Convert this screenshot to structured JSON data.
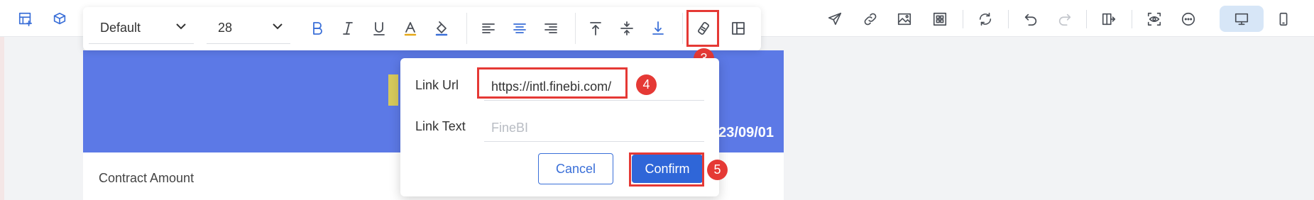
{
  "header": {
    "icons": [
      "add-chart-icon",
      "add-component-icon",
      "send-icon",
      "link-icon",
      "image-icon",
      "grid-icon",
      "refresh-icon",
      "undo-icon",
      "redo-icon",
      "export-icon",
      "preview-icon",
      "more-icon",
      "desktop-icon",
      "mobile-icon"
    ]
  },
  "toolbar": {
    "font_family": "Default",
    "font_size": "28",
    "buttons": [
      "bold-icon",
      "italic-icon",
      "underline-icon",
      "font-color-icon",
      "fill-color-icon",
      "align-left-icon",
      "align-center-icon",
      "align-right-icon",
      "align-top-icon",
      "align-middle-icon",
      "align-bottom-icon",
      "hyperlink-icon",
      "layout-icon"
    ]
  },
  "banner": {
    "date": "23/09/01"
  },
  "card": {
    "label": "Contract Amount"
  },
  "dialog": {
    "link_url_label": "Link Url",
    "link_url_value": "https://intl.finebi.com/",
    "link_text_label": "Link Text",
    "link_text_placeholder": "FineBI",
    "cancel_label": "Cancel",
    "confirm_label": "Confirm"
  },
  "steps": [
    "3",
    "4",
    "5"
  ],
  "colors": {
    "accent": "#2f66d8",
    "highlight": "#e53935",
    "banner": "#5c79e6"
  }
}
